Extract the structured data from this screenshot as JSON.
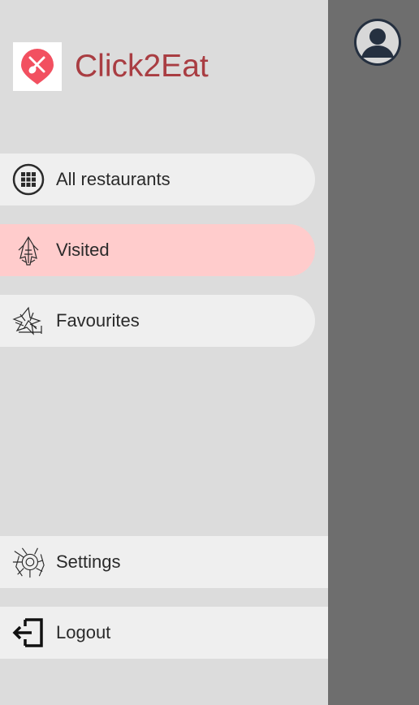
{
  "app": {
    "title": "Click2Eat",
    "brand_color": "#a93d42",
    "logo_color": "#f25060"
  },
  "nav": {
    "items": [
      {
        "label": "All restaurants",
        "icon": "grid-icon",
        "active": false
      },
      {
        "label": "Visited",
        "icon": "visited-sketch-icon",
        "active": true
      },
      {
        "label": "Favourites",
        "icon": "favourites-sketch-icon",
        "active": false
      }
    ]
  },
  "footer": {
    "settings_label": "Settings",
    "logout_label": "Logout"
  },
  "colors": {
    "drawer_bg": "#dcdcdc",
    "item_bg": "#efefef",
    "active_bg": "#ffcccc",
    "scrim": "#6e6e6e",
    "avatar": "#253040"
  }
}
